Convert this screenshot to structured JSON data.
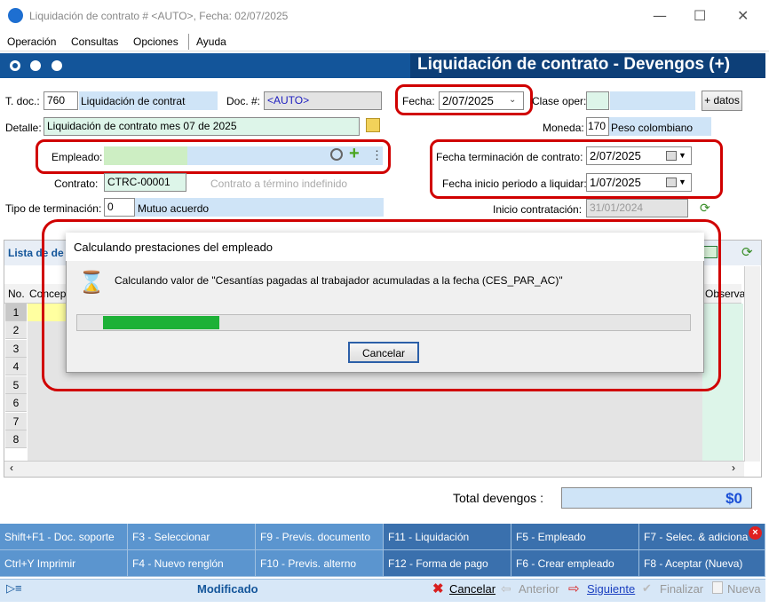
{
  "window": {
    "title": "Liquidación de contrato # <AUTO>, Fecha: 02/07/2025",
    "minimize": "—",
    "maximize": "☐",
    "close": "✕"
  },
  "menu": [
    "Operación",
    "Consultas",
    "Opciones",
    "Ayuda"
  ],
  "header": {
    "title": "Liquidación de contrato - Devengos (+)"
  },
  "form": {
    "tdoc_label": "T. doc.:",
    "tdoc_value": "760",
    "tdoc_name": "Liquidación de contrato",
    "docnum_label": "Doc. #:",
    "docnum_value": "<AUTO>",
    "fecha_label": "Fecha:",
    "fecha_value": "2/07/2025",
    "clase_label": "Clase oper:",
    "mas_datos": "+ datos",
    "detalle_label": "Detalle:",
    "detalle_value": "Liquidación de contrato mes 07 de 2025",
    "moneda_label": "Moneda:",
    "moneda_code": "170",
    "moneda_name": "Peso colombiano",
    "empleado_label": "Empleado:",
    "contrato_label": "Contrato:",
    "contrato_value": "CTRC-00001",
    "contrato_desc": "Contrato a término indefinido",
    "tipo_label": "Tipo de terminación:",
    "tipo_code": "0",
    "tipo_name": "Mutuo acuerdo",
    "fterm_label": "Fecha terminación de contrato:",
    "fterm_value": "2/07/2025",
    "finicio_label": "Fecha inicio periodo a liquidar:",
    "finicio_value": "1/07/2025",
    "icontr_label": "Inicio contratación:",
    "icontr_value": "31/01/2024"
  },
  "grid": {
    "title": "Lista de de",
    "col_no": "No.",
    "col_concepto": "Concep",
    "col_obs": "Observa",
    "rows": [
      "1",
      "2",
      "3",
      "4",
      "5",
      "6",
      "7",
      "8"
    ]
  },
  "dialog": {
    "title": "Calculando prestaciones del empleado",
    "message": "Calculando valor de \"Cesantías pagadas al trabajador acumuladas a la fecha (CES_PAR_AC)\"",
    "progress": 0.19,
    "cancel": "Cancelar"
  },
  "totals": {
    "label": "Total devengos :",
    "value": "$0"
  },
  "fkeys": {
    "row1": [
      "Shift+F1 - Doc. soporte",
      "F3 - Seleccionar",
      "F9 - Previs. documento",
      "F11 - Liquidación",
      "F5 - Empleado",
      "F7 - Selec. & adiciona"
    ],
    "row2": [
      "Ctrl+Y Imprimir",
      "F4 - Nuevo renglón",
      "F10 - Previs. alterno",
      "F12 - Forma de pago",
      "F6 - Crear empleado",
      "F8 - Aceptar (Nueva)"
    ]
  },
  "status": {
    "state": "Modificado",
    "cancelar": "Cancelar",
    "anterior": "Anterior",
    "siguiente": "Siguiente",
    "finalizar": "Finalizar",
    "nueva": "Nueva"
  },
  "colors": {
    "header": "#13559a",
    "highlight": "#d00000",
    "progress": "#1db137"
  }
}
